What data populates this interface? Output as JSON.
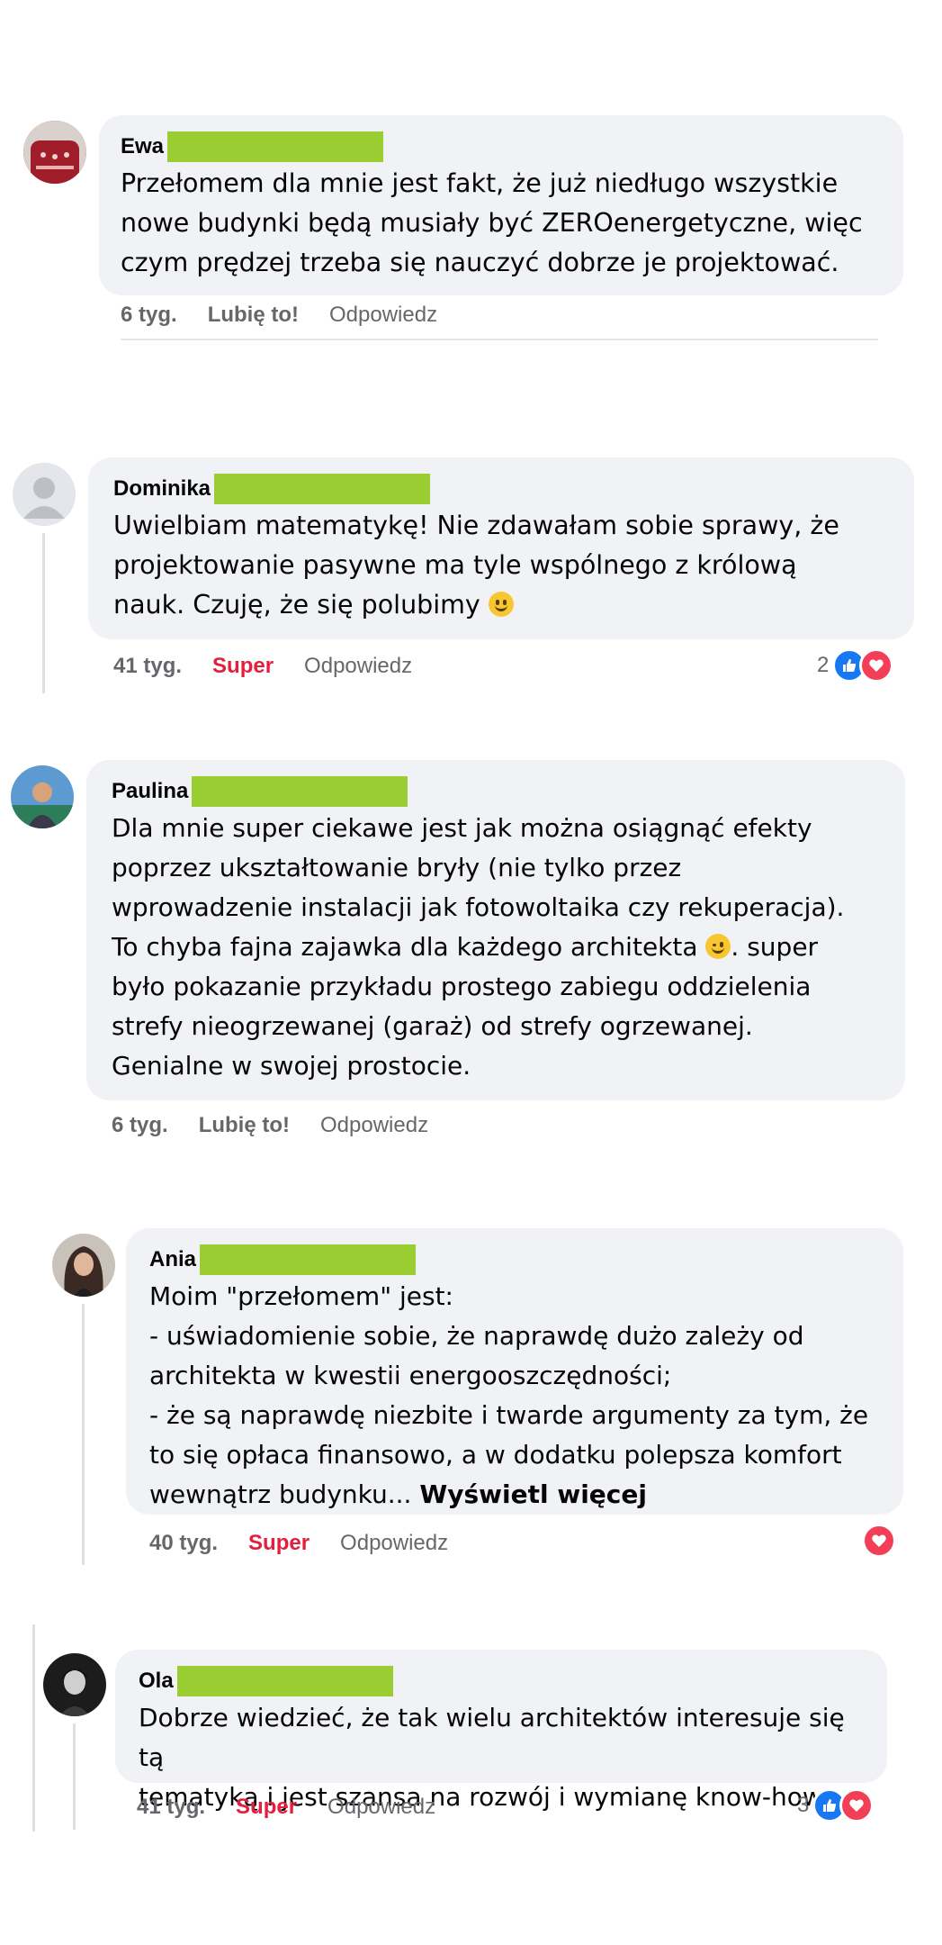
{
  "comments": [
    {
      "author": "Ewa",
      "text": "Przełomem dla mnie jest fakt, że już niedługo wszystkie\nnowe budynki będą musiały być ZEROenergetyczne, więc\nczym prędzej trzeba się nauczyć dobrze je projektować.",
      "time": "6 tyg.",
      "reaction_action": "Lubię to!",
      "reply": "Odpowiedz",
      "avatar_color": "#9b1b25"
    },
    {
      "author": "Dominika",
      "text_before_emoji": "Uwielbiam matematykę! Nie zdawałam sobie sprawy, że\nprojektowanie pasywne ma tyle wspólnego z królową\nnauk. Czuję, że się polubimy ",
      "time": "41 tyg.",
      "reaction_action": "Super",
      "reply": "Odpowiedz",
      "reaction_count": "2",
      "reaction_icons": [
        "like-icon",
        "love-icon"
      ],
      "avatar_color": "#bcc0c4"
    },
    {
      "author": "Paulina",
      "text_part1": "Dla mnie super ciekawe jest jak można osiągnąć efekty\npoprzez ukształtowanie bryły (nie tylko przez\nwprowadzenie instalacji jak fotowoltaika czy rekuperacja).\nTo chyba fajna zajawka dla każdego architekta ",
      "text_part2": ". super\nbyło pokazanie przykładu prostego zabiegu oddzielenia\nstrefy nieogrzewanej (garaż) od strefy ogrzewanej.\nGenialne w swojej prostocie.",
      "time": "6 tyg.",
      "reaction_action": "Lubię to!",
      "reply": "Odpowiedz",
      "avatar_color": "#3a7bb5"
    },
    {
      "author": "Ania",
      "text": "Moim \"przełomem\" jest:\n- uświadomienie sobie, że naprawdę dużo zależy od\narchitekta w kwestii energooszczędności;\n- że są naprawdę niezbite i twarde argumenty za tym, że\nto się opłaca finansowo, a w dodatku polepsza komfort\nwewnątrz budynku... ",
      "see_more": "Wyświetl więcej",
      "time": "40 tyg.",
      "reaction_action": "Super",
      "reply": "Odpowiedz",
      "reaction_icons": [
        "love-icon"
      ],
      "avatar_color": "#4a3a34"
    },
    {
      "author": "Ola",
      "text": "Dobrze wiedzieć, że tak wielu architektów interesuje się tą\ntematyką i jest szansa na rozwój i wymianę know-how",
      "time": "41 tyg.",
      "reaction_action": "Super",
      "reply": "Odpowiedz",
      "reaction_count": "3",
      "reaction_icons": [
        "like-icon",
        "love-icon"
      ],
      "avatar_color": "#2a2a2a"
    }
  ],
  "colors": {
    "bubble": "#f0f2f5",
    "meta": "#65676b",
    "super_red": "#e41e3f",
    "redaction": "#9acd32",
    "like_blue": "#1877f2",
    "love_red": "#f33e58"
  }
}
